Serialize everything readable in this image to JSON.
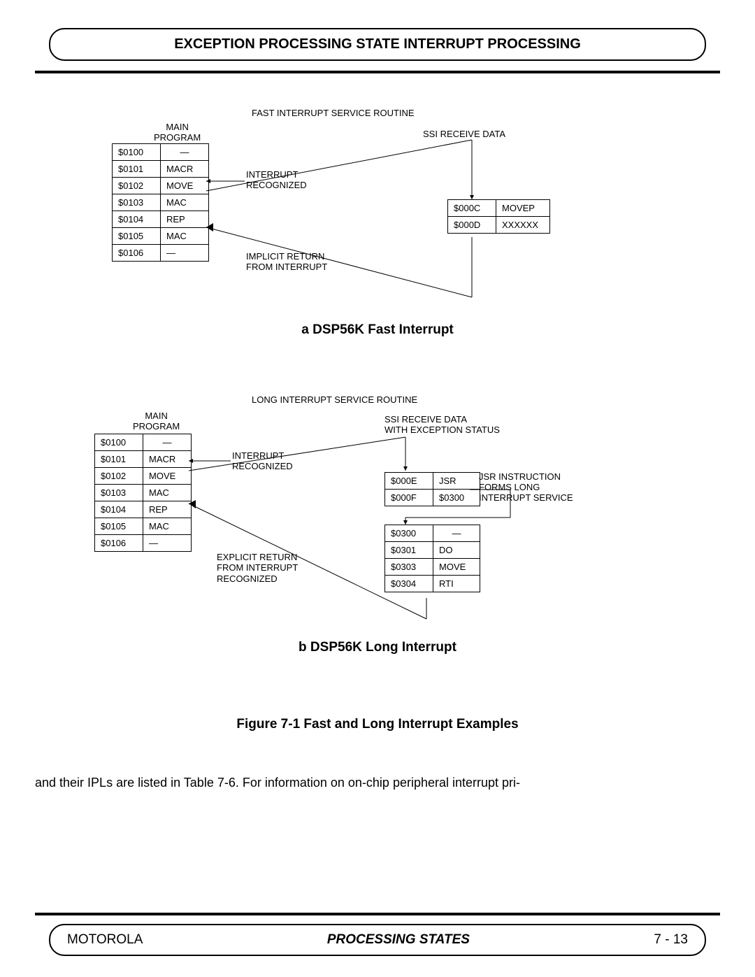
{
  "header": "EXCEPTION PROCESSING STATE INTERRUPT PROCESSING",
  "diagA": {
    "title": "FAST INTERRUPT SERVICE ROUTINE",
    "mainProgLabel": "MAIN\nPROGRAM",
    "ssiLabel": "SSI RECEIVE DATA",
    "intRecognized": "INTERRUPT\nRECOGNIZED",
    "implicitReturn": "IMPLICIT RETURN\nFROM INTERRUPT",
    "mainRows": [
      {
        "a": "$0100",
        "b": "—"
      },
      {
        "a": "$0101",
        "b": "MACR"
      },
      {
        "a": "$0102",
        "b": "MOVE"
      },
      {
        "a": "$0103",
        "b": "MAC"
      },
      {
        "a": "$0104",
        "b": "REP"
      },
      {
        "a": "$0105",
        "b": "MAC"
      },
      {
        "a": "$0106",
        "b": "—"
      }
    ],
    "isrRows": [
      {
        "a": "$000C",
        "b": "MOVEP"
      },
      {
        "a": "$000D",
        "b": "XXXXXX"
      }
    ],
    "caption": "a   DSP56K Fast Interrupt"
  },
  "diagB": {
    "title": "LONG INTERRUPT SERVICE ROUTINE",
    "mainProgLabel": "MAIN\nPROGRAM",
    "ssiLabel": "SSI RECEIVE DATA\nWITH EXCEPTION STATUS",
    "intRecognized": "INTERRUPT\nRECOGNIZED",
    "explicitReturn": "EXPLICIT RETURN\nFROM INTERRUPT",
    "recognized": "RECOGNIZED",
    "jsrNote": "JSR INSTRUCTION\nFORMS LONG\nINTERRUPT SERVICE",
    "mainRows": [
      {
        "a": "$0100",
        "b": "—"
      },
      {
        "a": "$0101",
        "b": "MACR"
      },
      {
        "a": "$0102",
        "b": "MOVE"
      },
      {
        "a": "$0103",
        "b": "MAC"
      },
      {
        "a": "$0104",
        "b": "REP"
      },
      {
        "a": "$0105",
        "b": "MAC"
      },
      {
        "a": "$0106",
        "b": "—"
      }
    ],
    "vecRows": [
      {
        "a": "$000E",
        "b": "JSR"
      },
      {
        "a": "$000F",
        "b": "$0300"
      }
    ],
    "isrRows": [
      {
        "a": "$0300",
        "b": "—"
      },
      {
        "a": "$0301",
        "b": "DO"
      },
      {
        "a": "$0303",
        "b": "MOVE"
      },
      {
        "a": "$0304",
        "b": "RTI"
      }
    ],
    "caption": "b  DSP56K Long Interrupt"
  },
  "figureCaption": "Figure  7-1  Fast and Long Interrupt Examples",
  "bodyText": "and their IPLs are listed in Table 7-6. For information on on-chip peripheral interrupt pri-",
  "footer": {
    "left": "MOTOROLA",
    "center": "PROCESSING STATES",
    "right": "7 - 13"
  }
}
